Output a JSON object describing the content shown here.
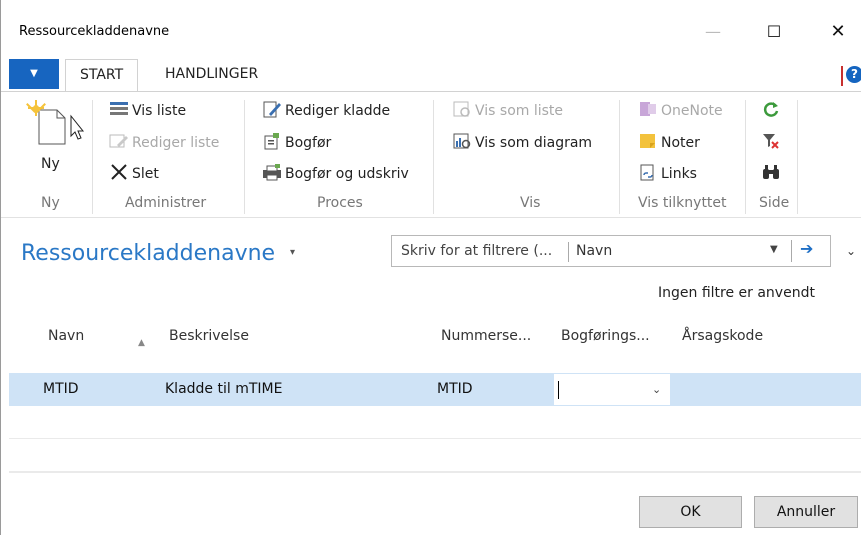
{
  "window": {
    "title": "Ressourcekladdenavne",
    "minimize": "—",
    "maximize": "☐",
    "close": "✕"
  },
  "ribbon": {
    "app_menu": "▼",
    "tabs": [
      "START",
      "HANDLINGER"
    ],
    "help": "?",
    "groups": {
      "ny": {
        "label": "Ny",
        "new_button": "Ny"
      },
      "administrer": {
        "label": "Administrer",
        "vis_liste": "Vis liste",
        "rediger_liste": "Rediger liste",
        "slet": "Slet"
      },
      "proces": {
        "label": "Proces",
        "rediger_kladde": "Rediger kladde",
        "bogfor": "Bogfør",
        "bogfor_udskriv": "Bogfør og udskriv"
      },
      "vis": {
        "label": "Vis",
        "vis_som_liste": "Vis som liste",
        "vis_som_diagram": "Vis som diagram"
      },
      "vis_tilknyttet": {
        "label": "Vis tilknyttet",
        "onenote": "OneNote",
        "noter": "Noter",
        "links": "Links"
      },
      "side": {
        "label": "Side"
      }
    }
  },
  "page": {
    "title": "Ressourcekladdenavne",
    "title_caret": "▾",
    "filter": {
      "placeholder": "Skriv for at filtrere (...",
      "field": "Navn",
      "dropdown": "▼",
      "go": "➔"
    },
    "expand": "⌄",
    "no_filters": "Ingen filtre er anvendt"
  },
  "table": {
    "columns": [
      "Navn",
      "Beskrivelse",
      "Nummerse...",
      "Bogførings...",
      "Årsagskode"
    ],
    "sort_indicator": "▲",
    "rows": [
      {
        "navn": "MTID",
        "beskrivelse": "Kladde til mTIME",
        "nummerserie": "MTID",
        "bogforing": "",
        "aarsagskode": ""
      }
    ],
    "edit_dropdown": "⌄"
  },
  "buttons": {
    "ok": "OK",
    "cancel": "Annuller"
  },
  "colors": {
    "accent": "#2a78c6",
    "selection": "#cfe3f6",
    "app_menu": "#1765c0"
  }
}
